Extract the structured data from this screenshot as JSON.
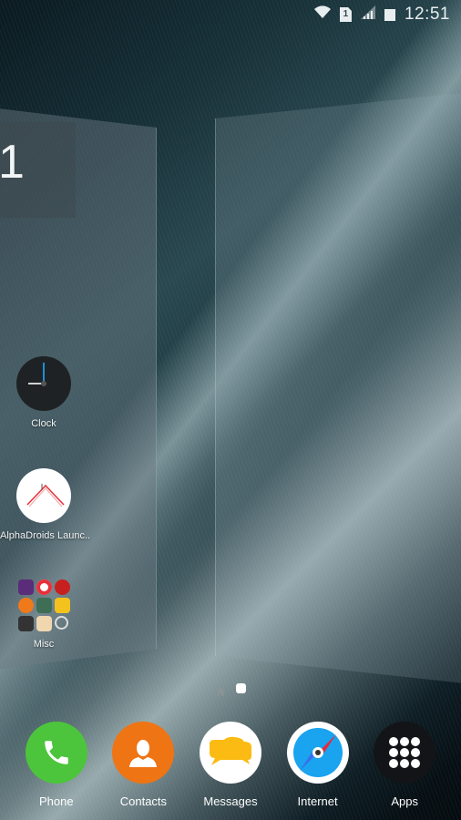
{
  "status_bar": {
    "time": "12:51",
    "sim_slot": "1",
    "icons": [
      "wifi-icon",
      "sim-card-icon",
      "signal-icon",
      "battery-icon"
    ]
  },
  "left_panel": {
    "widget_text": "1",
    "apps": [
      {
        "label": "Clock",
        "icon": "clock-icon"
      },
      {
        "label": "AlphaDroids Launc..",
        "icon": "alphadroids-launcher-icon"
      },
      {
        "label": "Misc",
        "icon": "folder-icon"
      }
    ],
    "misc_folder_colors": [
      "#5a2c7a",
      "#ffffff",
      "#c8201e",
      "#f07a1a",
      "#3e6e56",
      "#f3c21c",
      "#333333",
      "#f1d7b0",
      "#cccccc"
    ]
  },
  "page_indicator": {
    "pages": [
      "home",
      "page"
    ],
    "active_index": 1
  },
  "dock": {
    "apps": [
      {
        "label": "Phone",
        "color": "#4cc53c"
      },
      {
        "label": "Contacts",
        "color": "#ef7414"
      },
      {
        "label": "Messages",
        "color": "#ffffff"
      },
      {
        "label": "Internet",
        "color": "#ffffff"
      },
      {
        "label": "Apps",
        "color": "#121417"
      }
    ]
  }
}
